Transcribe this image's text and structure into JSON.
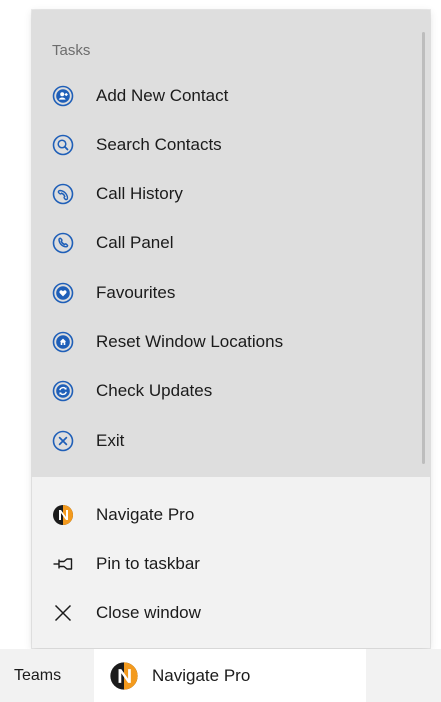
{
  "jumplist": {
    "section_title": "Tasks",
    "tasks": [
      {
        "label": "Add New Contact",
        "icon": "add-contact-icon"
      },
      {
        "label": "Search Contacts",
        "icon": "search-icon"
      },
      {
        "label": "Call History",
        "icon": "call-history-icon"
      },
      {
        "label": "Call Panel",
        "icon": "phone-icon"
      },
      {
        "label": "Favourites",
        "icon": "heart-icon"
      },
      {
        "label": "Reset Window Locations",
        "icon": "home-icon"
      },
      {
        "label": "Check Updates",
        "icon": "refresh-icon"
      },
      {
        "label": "Exit",
        "icon": "close-circle-icon"
      }
    ],
    "bottom_items": [
      {
        "label": "Navigate Pro",
        "icon": "navigate-pro-logo-icon"
      },
      {
        "label": "Pin to taskbar",
        "icon": "pin-icon"
      },
      {
        "label": "Close window",
        "icon": "close-icon"
      }
    ]
  },
  "taskbar": {
    "teams_label": "Teams",
    "app_label": "Navigate Pro"
  },
  "colors": {
    "icon_blue": "#1f5fb8",
    "logo_orange": "#f39a1e",
    "logo_dark": "#1b1b1b",
    "tasks_bg": "#dedede",
    "menu_bg": "#f2f2f2"
  }
}
